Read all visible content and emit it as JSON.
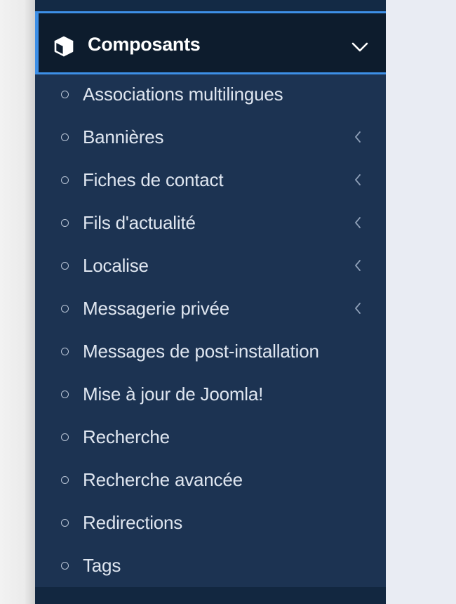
{
  "sidebar": {
    "section": {
      "title": "Composants",
      "icon": "cube-icon",
      "toggle_icon": "chevron-down-icon",
      "accent_color": "#3d8fe6"
    },
    "items": [
      {
        "label": "Associations multilingues",
        "has_submenu": false
      },
      {
        "label": "Bannières",
        "has_submenu": true
      },
      {
        "label": "Fiches de contact",
        "has_submenu": true
      },
      {
        "label": "Fils d'actualité",
        "has_submenu": true
      },
      {
        "label": "Localise",
        "has_submenu": true
      },
      {
        "label": "Messagerie privée",
        "has_submenu": true
      },
      {
        "label": "Messages de post-installation",
        "has_submenu": false
      },
      {
        "label": "Mise à jour de Joomla!",
        "has_submenu": false
      },
      {
        "label": "Recherche",
        "has_submenu": false
      },
      {
        "label": "Recherche avancée",
        "has_submenu": false
      },
      {
        "label": "Redirections",
        "has_submenu": false
      },
      {
        "label": "Tags",
        "has_submenu": false
      }
    ]
  }
}
